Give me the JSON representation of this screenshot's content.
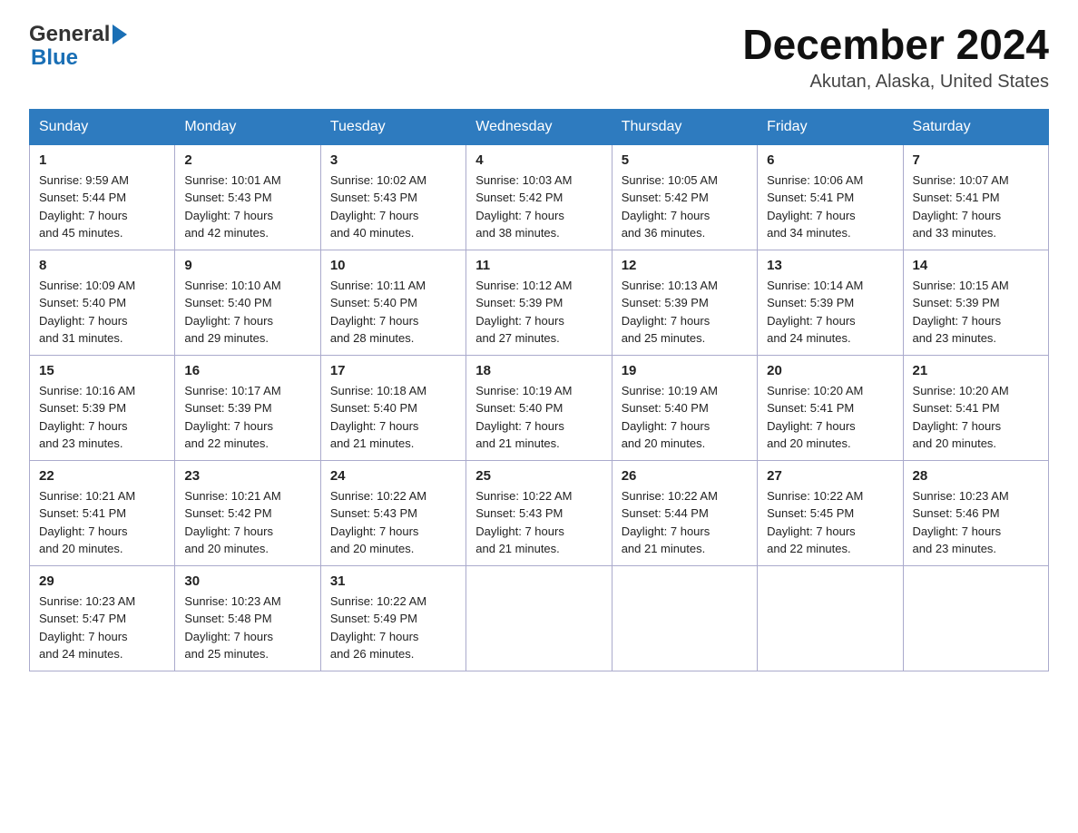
{
  "logo": {
    "general": "General",
    "blue": "Blue"
  },
  "header": {
    "month": "December 2024",
    "location": "Akutan, Alaska, United States"
  },
  "weekdays": [
    "Sunday",
    "Monday",
    "Tuesday",
    "Wednesday",
    "Thursday",
    "Friday",
    "Saturday"
  ],
  "weeks": [
    [
      {
        "day": "1",
        "sunrise": "Sunrise: 9:59 AM",
        "sunset": "Sunset: 5:44 PM",
        "daylight": "Daylight: 7 hours",
        "minutes": "and 45 minutes."
      },
      {
        "day": "2",
        "sunrise": "Sunrise: 10:01 AM",
        "sunset": "Sunset: 5:43 PM",
        "daylight": "Daylight: 7 hours",
        "minutes": "and 42 minutes."
      },
      {
        "day": "3",
        "sunrise": "Sunrise: 10:02 AM",
        "sunset": "Sunset: 5:43 PM",
        "daylight": "Daylight: 7 hours",
        "minutes": "and 40 minutes."
      },
      {
        "day": "4",
        "sunrise": "Sunrise: 10:03 AM",
        "sunset": "Sunset: 5:42 PM",
        "daylight": "Daylight: 7 hours",
        "minutes": "and 38 minutes."
      },
      {
        "day": "5",
        "sunrise": "Sunrise: 10:05 AM",
        "sunset": "Sunset: 5:42 PM",
        "daylight": "Daylight: 7 hours",
        "minutes": "and 36 minutes."
      },
      {
        "day": "6",
        "sunrise": "Sunrise: 10:06 AM",
        "sunset": "Sunset: 5:41 PM",
        "daylight": "Daylight: 7 hours",
        "minutes": "and 34 minutes."
      },
      {
        "day": "7",
        "sunrise": "Sunrise: 10:07 AM",
        "sunset": "Sunset: 5:41 PM",
        "daylight": "Daylight: 7 hours",
        "minutes": "and 33 minutes."
      }
    ],
    [
      {
        "day": "8",
        "sunrise": "Sunrise: 10:09 AM",
        "sunset": "Sunset: 5:40 PM",
        "daylight": "Daylight: 7 hours",
        "minutes": "and 31 minutes."
      },
      {
        "day": "9",
        "sunrise": "Sunrise: 10:10 AM",
        "sunset": "Sunset: 5:40 PM",
        "daylight": "Daylight: 7 hours",
        "minutes": "and 29 minutes."
      },
      {
        "day": "10",
        "sunrise": "Sunrise: 10:11 AM",
        "sunset": "Sunset: 5:40 PM",
        "daylight": "Daylight: 7 hours",
        "minutes": "and 28 minutes."
      },
      {
        "day": "11",
        "sunrise": "Sunrise: 10:12 AM",
        "sunset": "Sunset: 5:39 PM",
        "daylight": "Daylight: 7 hours",
        "minutes": "and 27 minutes."
      },
      {
        "day": "12",
        "sunrise": "Sunrise: 10:13 AM",
        "sunset": "Sunset: 5:39 PM",
        "daylight": "Daylight: 7 hours",
        "minutes": "and 25 minutes."
      },
      {
        "day": "13",
        "sunrise": "Sunrise: 10:14 AM",
        "sunset": "Sunset: 5:39 PM",
        "daylight": "Daylight: 7 hours",
        "minutes": "and 24 minutes."
      },
      {
        "day": "14",
        "sunrise": "Sunrise: 10:15 AM",
        "sunset": "Sunset: 5:39 PM",
        "daylight": "Daylight: 7 hours",
        "minutes": "and 23 minutes."
      }
    ],
    [
      {
        "day": "15",
        "sunrise": "Sunrise: 10:16 AM",
        "sunset": "Sunset: 5:39 PM",
        "daylight": "Daylight: 7 hours",
        "minutes": "and 23 minutes."
      },
      {
        "day": "16",
        "sunrise": "Sunrise: 10:17 AM",
        "sunset": "Sunset: 5:39 PM",
        "daylight": "Daylight: 7 hours",
        "minutes": "and 22 minutes."
      },
      {
        "day": "17",
        "sunrise": "Sunrise: 10:18 AM",
        "sunset": "Sunset: 5:40 PM",
        "daylight": "Daylight: 7 hours",
        "minutes": "and 21 minutes."
      },
      {
        "day": "18",
        "sunrise": "Sunrise: 10:19 AM",
        "sunset": "Sunset: 5:40 PM",
        "daylight": "Daylight: 7 hours",
        "minutes": "and 21 minutes."
      },
      {
        "day": "19",
        "sunrise": "Sunrise: 10:19 AM",
        "sunset": "Sunset: 5:40 PM",
        "daylight": "Daylight: 7 hours",
        "minutes": "and 20 minutes."
      },
      {
        "day": "20",
        "sunrise": "Sunrise: 10:20 AM",
        "sunset": "Sunset: 5:41 PM",
        "daylight": "Daylight: 7 hours",
        "minutes": "and 20 minutes."
      },
      {
        "day": "21",
        "sunrise": "Sunrise: 10:20 AM",
        "sunset": "Sunset: 5:41 PM",
        "daylight": "Daylight: 7 hours",
        "minutes": "and 20 minutes."
      }
    ],
    [
      {
        "day": "22",
        "sunrise": "Sunrise: 10:21 AM",
        "sunset": "Sunset: 5:41 PM",
        "daylight": "Daylight: 7 hours",
        "minutes": "and 20 minutes."
      },
      {
        "day": "23",
        "sunrise": "Sunrise: 10:21 AM",
        "sunset": "Sunset: 5:42 PM",
        "daylight": "Daylight: 7 hours",
        "minutes": "and 20 minutes."
      },
      {
        "day": "24",
        "sunrise": "Sunrise: 10:22 AM",
        "sunset": "Sunset: 5:43 PM",
        "daylight": "Daylight: 7 hours",
        "minutes": "and 20 minutes."
      },
      {
        "day": "25",
        "sunrise": "Sunrise: 10:22 AM",
        "sunset": "Sunset: 5:43 PM",
        "daylight": "Daylight: 7 hours",
        "minutes": "and 21 minutes."
      },
      {
        "day": "26",
        "sunrise": "Sunrise: 10:22 AM",
        "sunset": "Sunset: 5:44 PM",
        "daylight": "Daylight: 7 hours",
        "minutes": "and 21 minutes."
      },
      {
        "day": "27",
        "sunrise": "Sunrise: 10:22 AM",
        "sunset": "Sunset: 5:45 PM",
        "daylight": "Daylight: 7 hours",
        "minutes": "and 22 minutes."
      },
      {
        "day": "28",
        "sunrise": "Sunrise: 10:23 AM",
        "sunset": "Sunset: 5:46 PM",
        "daylight": "Daylight: 7 hours",
        "minutes": "and 23 minutes."
      }
    ],
    [
      {
        "day": "29",
        "sunrise": "Sunrise: 10:23 AM",
        "sunset": "Sunset: 5:47 PM",
        "daylight": "Daylight: 7 hours",
        "minutes": "and 24 minutes."
      },
      {
        "day": "30",
        "sunrise": "Sunrise: 10:23 AM",
        "sunset": "Sunset: 5:48 PM",
        "daylight": "Daylight: 7 hours",
        "minutes": "and 25 minutes."
      },
      {
        "day": "31",
        "sunrise": "Sunrise: 10:22 AM",
        "sunset": "Sunset: 5:49 PM",
        "daylight": "Daylight: 7 hours",
        "minutes": "and 26 minutes."
      },
      null,
      null,
      null,
      null
    ]
  ]
}
